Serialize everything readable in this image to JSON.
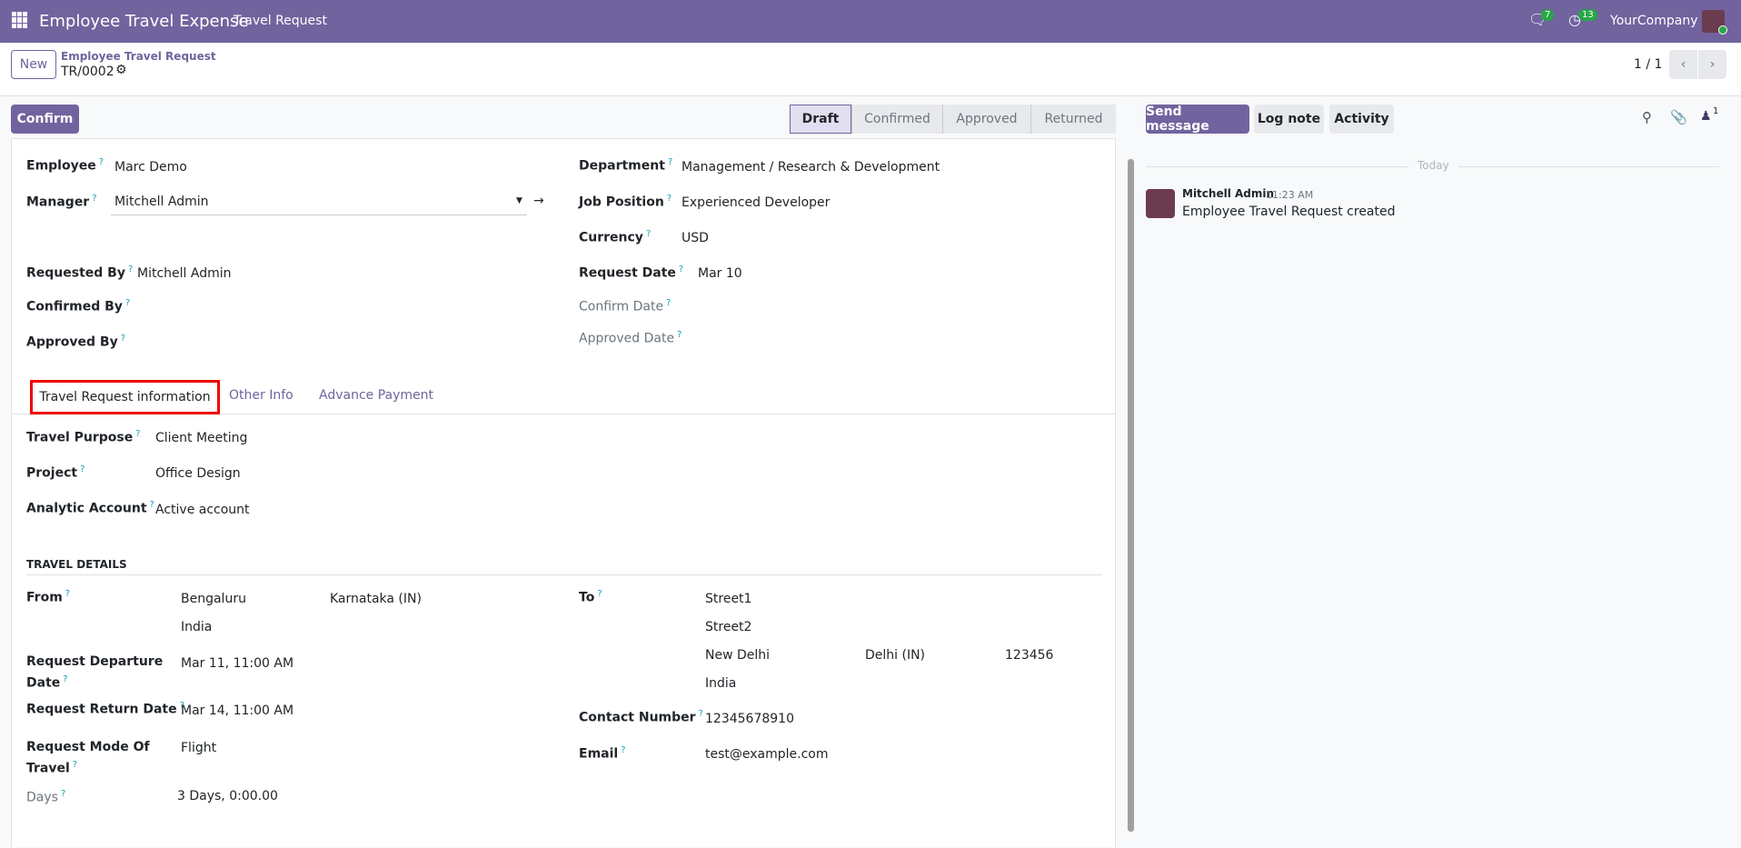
{
  "navbar": {
    "app_title": "Employee Travel Expense",
    "menu_item": "Travel Request",
    "messages_count": "7",
    "activities_count": "13",
    "company": "YourCompany"
  },
  "control_panel": {
    "new_label": "New",
    "breadcrumb_parent": "Employee Travel Request",
    "record_name": "TR/0002",
    "pager": "1 / 1"
  },
  "statusbar": {
    "confirm_label": "Confirm",
    "stages": [
      "Draft",
      "Confirmed",
      "Approved",
      "Returned"
    ],
    "active_stage": "Draft"
  },
  "form": {
    "employee": {
      "label": "Employee",
      "value": "Marc Demo"
    },
    "manager": {
      "label": "Manager",
      "value": "Mitchell Admin"
    },
    "requested_by": {
      "label": "Requested By",
      "value": "Mitchell Admin"
    },
    "confirmed_by": {
      "label": "Confirmed By"
    },
    "approved_by": {
      "label": "Approved By"
    },
    "department": {
      "label": "Department",
      "value": "Management / Research & Development"
    },
    "job_position": {
      "label": "Job Position",
      "value": "Experienced Developer"
    },
    "currency": {
      "label": "Currency",
      "value": "USD"
    },
    "request_date": {
      "label": "Request Date",
      "value": "Mar 10"
    },
    "confirm_date": {
      "label": "Confirm Date"
    },
    "approved_date": {
      "label": "Approved Date"
    }
  },
  "tabs": [
    "Travel Request information",
    "Other Info",
    "Advance Payment"
  ],
  "travel_info": {
    "purpose": {
      "label": "Travel Purpose",
      "value": "Client Meeting"
    },
    "project": {
      "label": "Project",
      "value": "Office Design"
    },
    "analytic": {
      "label": "Analytic Account",
      "value": "Active account"
    }
  },
  "travel_details": {
    "heading": "TRAVEL DETAILS",
    "from": {
      "label": "From",
      "city": "Bengaluru",
      "state": "Karnataka (IN)",
      "country": "India"
    },
    "departure": {
      "label_1": "Request Departure",
      "label_2": "Date",
      "value": "Mar 11, 11:00 AM"
    },
    "return": {
      "label": "Request Return Date",
      "value": "Mar 14, 11:00 AM"
    },
    "mode": {
      "label_1": "Request Mode Of",
      "label_2": "Travel",
      "value": "Flight"
    },
    "days": {
      "label": "Days",
      "value": "3 Days, 0:00.00"
    },
    "to": {
      "label": "To",
      "street1": "Street1",
      "street2": "Street2",
      "city": "New Delhi",
      "state": "Delhi (IN)",
      "zip": "123456",
      "country": "India"
    },
    "contact": {
      "label": "Contact Number",
      "value": "12345678910"
    },
    "email": {
      "label": "Email",
      "value": "test@example.com"
    }
  },
  "chatter": {
    "send_message": "Send message",
    "log_note": "Log note",
    "activity": "Activity",
    "followers_count": "1",
    "date_separator": "Today",
    "messages": [
      {
        "author": "Mitchell Admin",
        "time": "11:23 AM",
        "body": "Employee Travel Request created"
      }
    ]
  },
  "colors": {
    "brand": "#71639e",
    "badge": "#28a745"
  }
}
